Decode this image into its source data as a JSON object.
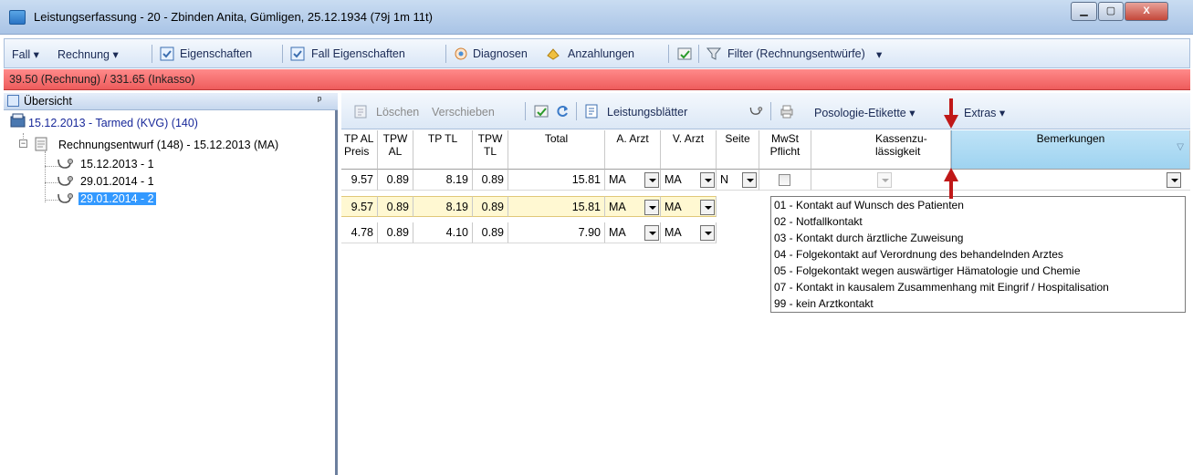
{
  "window": {
    "title": "Leistungserfassung - 20 - Zbinden Anita, Gümligen, 25.12.1934 (79j 1m 11t)",
    "min_glyph": "▁",
    "max_glyph": "▢",
    "close_glyph": "X"
  },
  "menubar": {
    "fall": "Fall ▾",
    "rechnung": "Rechnung ▾",
    "eigenschaften": "Eigenschaften",
    "fall_eigenschaften": "Fall Eigenschaften",
    "diagnosen": "Diagnosen",
    "anzahlungen": "Anzahlungen",
    "filter": "Filter (Rechnungsentwürfe)",
    "more": "▾"
  },
  "status": {
    "text": "39.50 (Rechnung) / 331.65 (Inkasso)",
    "color": "#f06a6a"
  },
  "overview": {
    "header": "Übersicht",
    "pin": "ᵖ",
    "nodes": [
      {
        "label": "15.12.2013 - Tarmed (KVG) (140)"
      },
      {
        "label": "Rechnungsentwurf (148) - 15.12.2013 (MA)"
      },
      {
        "label": "15.12.2013 - 1"
      },
      {
        "label": "29.01.2014 - 1"
      },
      {
        "label": "29.01.2014 - 2"
      }
    ]
  },
  "toolbar": {
    "loeschen": "Löschen",
    "verschieben": "Verschieben",
    "leistungsblaetter": "Leistungsblätter",
    "posologie": "Posologie-Etikette ▾",
    "extras": "Extras ▾"
  },
  "grid": {
    "headers": {
      "tp_al_preis": "TP AL Preis",
      "tpw_al": "TPW AL",
      "tp_tl": "TP TL",
      "tpw_tl": "TPW TL",
      "total": "Total",
      "a_arzt": "A. Arzt",
      "v_arzt": "V. Arzt",
      "seite": "Seite",
      "mwst": "MwSt Pflicht",
      "kassen": "Kassenzu-lässigkeit",
      "bemerkungen": "Bemerkungen"
    },
    "rows": [
      {
        "tp_al_preis": "9.57",
        "tpw_al": "0.89",
        "tp_tl": "8.19",
        "tpw_tl": "0.89",
        "total": "15.81",
        "a_arzt": "MA",
        "v_arzt": "MA",
        "seite": "N"
      },
      {
        "tp_al_preis": "9.57",
        "tpw_al": "0.89",
        "tp_tl": "8.19",
        "tpw_tl": "0.89",
        "total": "15.81",
        "a_arzt": "MA",
        "v_arzt": "MA"
      },
      {
        "tp_al_preis": "4.78",
        "tpw_al": "0.89",
        "tp_tl": "4.10",
        "tpw_tl": "0.89",
        "total": "7.90",
        "a_arzt": "MA",
        "v_arzt": "MA"
      }
    ]
  },
  "kontakt_options": [
    "01 - Kontakt auf Wunsch des Patienten",
    "02 - Notfallkontakt",
    "03 - Kontakt durch ärztliche Zuweisung",
    "04 - Folgekontakt auf Verordnung des behandelnden Arztes",
    "05 - Folgekontakt wegen auswärtiger Hämatologie und Chemie",
    "07 - Kontakt in kausalem Zusammenhang mit Eingrif / Hospitalisation",
    "99 - kein Arztkontakt"
  ],
  "colors": {
    "selection": "#3399ff",
    "row_highlight": "#fff8d2",
    "annotation_arrow": "#c01818"
  }
}
